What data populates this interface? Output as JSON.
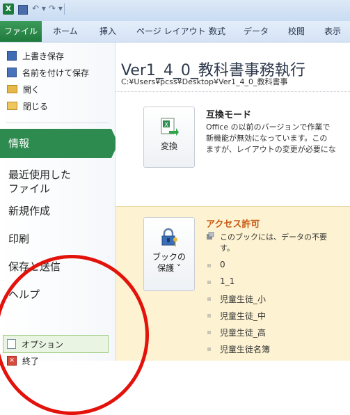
{
  "app": {
    "excel_icon": "X",
    "tabs": [
      "ファイル",
      "ホーム",
      "挿入",
      "ページ レイアウト",
      "数式",
      "データ",
      "校閲",
      "表示"
    ]
  },
  "nav": {
    "commands_top": [
      {
        "label": "上書き保存",
        "icon": "save-icon"
      },
      {
        "label": "名前を付けて保存",
        "icon": "save-as-icon"
      },
      {
        "label": "開く",
        "icon": "open-folder-icon"
      },
      {
        "label": "閉じる",
        "icon": "close-folder-icon"
      }
    ],
    "info": "情報",
    "recent_line1": "最近使用した",
    "recent_line2": "ファイル",
    "new": "新規作成",
    "print": "印刷",
    "save_send": "保存と送信",
    "help": "ヘルプ",
    "options": "オプション",
    "exit": "終了",
    "exit_icon_glyph": "×"
  },
  "main": {
    "doc_title": "Ver1_4_0_教科書事務執行",
    "doc_path": "C:¥Users¥pcss¥Desktop¥Ver1_4_0_教科書事",
    "compat": {
      "button_label": "変換",
      "title": "互換モード",
      "line1": "Office の以前のバージョンで作業で",
      "line2": "新機能が無効になっています。この",
      "line3": "ますが、レイアウトの変更が必要にな"
    },
    "permissions": {
      "button_label_line1": "ブックの",
      "button_label_line2": "保護 ˅",
      "title": "アクセス許可",
      "desc_line1": "このブックには、データの不要",
      "desc_line2": "す。",
      "items": [
        "0",
        "1_1",
        "児童生徒_小",
        "児童生徒_中",
        "児童生徒_高",
        "児童生徒名簿"
      ]
    }
  },
  "colors": {
    "file_tab": "#1f7a3c",
    "info_selected": "#2e8b4f",
    "annotation_circle": "#e3120b",
    "permissions_bg": "#fdf3d2",
    "permissions_title": "#c85a14"
  }
}
